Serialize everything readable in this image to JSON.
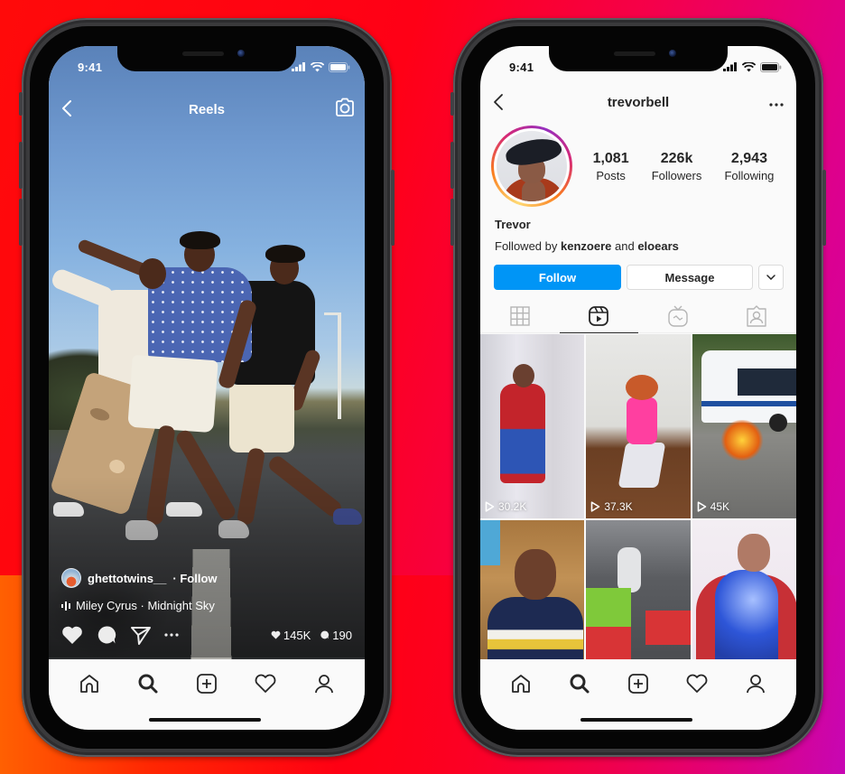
{
  "status_bar": {
    "time": "9:41"
  },
  "reels_screen": {
    "header": {
      "title": "Reels",
      "back_icon": "chevron-left-icon",
      "camera_icon": "camera-icon"
    },
    "post": {
      "username": "ghettotwins__",
      "follow_label": "· Follow",
      "music": "Miley Cyrus · Midnight Sky",
      "likes": "145K",
      "comments": "190"
    },
    "actions": [
      "like-icon",
      "comment-icon",
      "share-icon",
      "more-icon"
    ]
  },
  "profile_screen": {
    "header": {
      "username": "trevorbell",
      "back_icon": "chevron-left-icon",
      "more_icon": "more-horizontal-icon"
    },
    "stats": [
      {
        "value": "1,081",
        "label": "Posts"
      },
      {
        "value": "226k",
        "label": "Followers"
      },
      {
        "value": "2,943",
        "label": "Following"
      }
    ],
    "name": "Trevor",
    "followed_by": {
      "prefix": "Followed by",
      "user1": "kenzoere",
      "joiner": "and",
      "user2": "eloears"
    },
    "buttons": {
      "follow": "Follow",
      "message": "Message"
    },
    "tabs": [
      {
        "icon": "grid-icon",
        "active": false
      },
      {
        "icon": "reels-icon",
        "active": true
      },
      {
        "icon": "igtv-icon",
        "active": false
      },
      {
        "icon": "tagged-icon",
        "active": false
      }
    ],
    "grid": [
      {
        "views": "30.2K"
      },
      {
        "views": "37.3K"
      },
      {
        "views": "45K"
      },
      {
        "views": ""
      },
      {
        "views": ""
      },
      {
        "views": ""
      }
    ]
  },
  "bottom_nav": [
    "home-icon",
    "search-icon",
    "new-post-icon",
    "activity-icon",
    "profile-icon"
  ],
  "colors": {
    "follow_blue": "#0095f6",
    "text": "#262626",
    "background_gradient": [
      "#ff0a0a",
      "#f5004a",
      "#c706b4"
    ]
  }
}
